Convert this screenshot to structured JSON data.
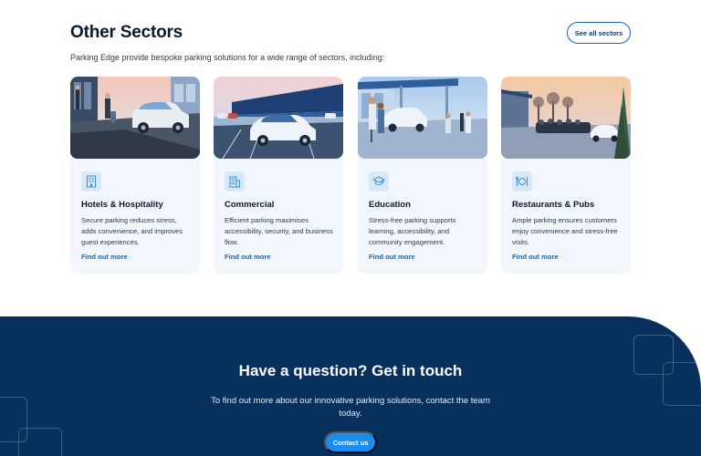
{
  "sectors": {
    "title": "Other Sectors",
    "subtitle": "Parking Edge provide bespoke parking solutions for a wide range of sectors, including:",
    "see_all_label": "See all sectors",
    "cards": [
      {
        "title": "Hotels & Hospitality",
        "description": "Secure parking reduces stress, adds convenience, and improves guest experiences.",
        "link": "Find out more",
        "icon": "hotel-building-icon"
      },
      {
        "title": "Commercial",
        "description": "Efficient parking maximises accessibility, security, and business flow.",
        "link": "Find out more",
        "icon": "office-building-icon"
      },
      {
        "title": "Education",
        "description": "Stress-free parking supports learning, accessibility, and community engagement.",
        "link": "Find out more",
        "icon": "graduation-cap-icon"
      },
      {
        "title": "Restaurants & Pubs",
        "description": "Ample parking ensures customers enjoy convenience and stress-free visits.",
        "link": "Find out more",
        "icon": "dining-plate-icon"
      }
    ]
  },
  "contact": {
    "title": "Have a question? Get in touch",
    "description": "To find out more about our innovative parking solutions, contact the team today.",
    "button_label": "Contact us"
  },
  "colors": {
    "navy": "#07305d",
    "accent_blue": "#1a8df0",
    "link_blue": "#1a63b5",
    "card_bg": "#f1f7fd"
  }
}
